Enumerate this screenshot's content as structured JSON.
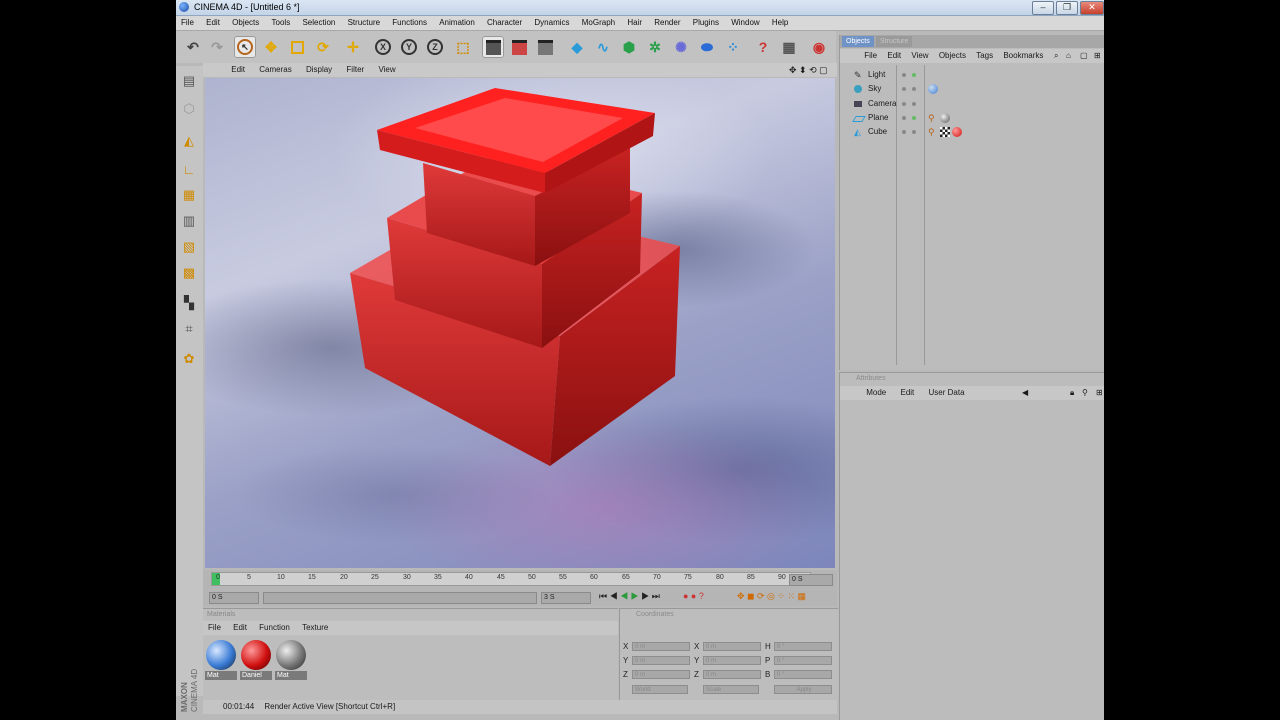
{
  "window": {
    "title": "CINEMA 4D - [Untitled 6 *]",
    "buttons": [
      "–",
      "❐",
      "✕"
    ]
  },
  "menubar": [
    "File",
    "Edit",
    "Objects",
    "Tools",
    "Selection",
    "Structure",
    "Functions",
    "Animation",
    "Character",
    "Dynamics",
    "MoGraph",
    "Hair",
    "Render",
    "Plugins",
    "Window",
    "Help"
  ],
  "viewport": {
    "menu": [
      "Edit",
      "Cameras",
      "Display",
      "Filter",
      "View"
    ]
  },
  "timeline": {
    "ticks": [
      "0",
      "5",
      "10",
      "15",
      "20",
      "25",
      "30",
      "35",
      "40",
      "45",
      "50",
      "55",
      "60",
      "65",
      "70",
      "75",
      "80",
      "85",
      "90"
    ],
    "current_frame": "0 S",
    "start_field": "0 S",
    "end_field": "3 S"
  },
  "materials": {
    "header": "Materials",
    "menu": [
      "File",
      "Edit",
      "Function",
      "Texture"
    ],
    "items": [
      {
        "label": "Mat",
        "color": "#3a7bd5"
      },
      {
        "label": "Daniel",
        "color": "#d01010"
      },
      {
        "label": "Mat",
        "color": "#777777"
      }
    ]
  },
  "coordinates": {
    "header": "Coordinates",
    "col1": [
      "X",
      "Y",
      "Z"
    ],
    "col2": [
      "X",
      "Y",
      "Z"
    ],
    "col3": [
      "H",
      "P",
      "B"
    ],
    "values": [
      "0 m",
      "0 m",
      "0 m",
      "0 m",
      "0 m",
      "0 m",
      "0 °",
      "0 °",
      "0 °"
    ],
    "mode1": "World",
    "mode2": "Scale",
    "apply": "Apply"
  },
  "status": {
    "time": "00:01:44",
    "message": "Render Active View [Shortcut Ctrl+R]"
  },
  "brand": {
    "line1": "MAXON",
    "line2": "CINEMA 4D"
  },
  "objects_panel": {
    "tabs": [
      "Objects",
      "Structure"
    ],
    "menu": [
      "File",
      "Edit",
      "View",
      "Objects",
      "Tags",
      "Bookmarks"
    ],
    "objects": [
      {
        "name": "Light",
        "icon": "light-icon"
      },
      {
        "name": "Sky",
        "icon": "sky-icon"
      },
      {
        "name": "Camera",
        "icon": "camera-icon"
      },
      {
        "name": "Plane",
        "icon": "plane-icon"
      },
      {
        "name": "Cube",
        "icon": "cube-icon"
      }
    ]
  },
  "attributes_panel": {
    "header": "Attributes",
    "menu": [
      "Mode",
      "Edit",
      "User Data"
    ]
  },
  "colors": {
    "accent": "#6f93c7",
    "object_red": "#e01a1a"
  }
}
